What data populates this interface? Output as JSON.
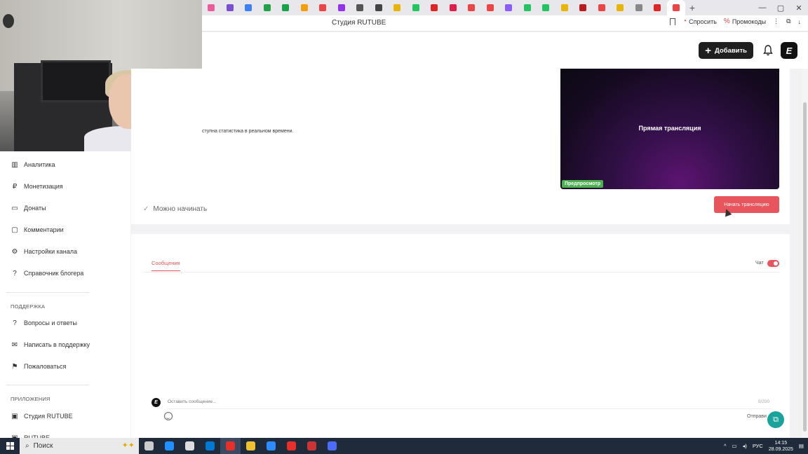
{
  "browser": {
    "page_title": "Студия RUTUBE",
    "tab_colors": [
      "#e85d9a",
      "#7a4fd6",
      "#3b82f6",
      "#22a34a",
      "#16a34a",
      "#f59e0b",
      "#ef4444",
      "#9333ea",
      "#555555",
      "#444444",
      "#eab308",
      "#22c55e",
      "#dc2626",
      "#e11d48",
      "#ef4444",
      "#ef4444",
      "#8b5cf6",
      "#22c55e",
      "#22c55e",
      "#eab308",
      "#b91c1c",
      "#ef4444",
      "#eab308",
      "#888888",
      "#dc2626",
      "#ef4444"
    ],
    "new_tab_symbol": "+",
    "ask_label": "Спросить",
    "promo_label": "Промокоды",
    "menu_symbol": "⋮"
  },
  "header": {
    "add_button_label": "Добавить",
    "plus_symbol": "+",
    "brand_letter": "E"
  },
  "sidebar": {
    "items": [
      {
        "label": "Аналитика",
        "icon": "chart-icon",
        "glyph": "▥"
      },
      {
        "label": "Монетизация",
        "icon": "ruble-icon",
        "glyph": "₽"
      },
      {
        "label": "Донаты",
        "icon": "wallet-icon",
        "glyph": "▭"
      },
      {
        "label": "Комментарии",
        "icon": "comments-icon",
        "glyph": "▢"
      },
      {
        "label": "Настройки канала",
        "icon": "gear-icon",
        "glyph": "⚙"
      },
      {
        "label": "Справочник блогера",
        "icon": "help-icon",
        "glyph": "?"
      }
    ],
    "support_group": "ПОДДЕРЖКА",
    "support_items": [
      {
        "label": "Вопросы и ответы",
        "icon": "question-icon",
        "glyph": "?"
      },
      {
        "label": "Написать в поддержку",
        "icon": "mail-icon",
        "glyph": "✉"
      },
      {
        "label": "Пожаловаться",
        "icon": "flag-icon",
        "glyph": "⚑"
      }
    ],
    "apps_group": "ПРИЛОЖЕНИЯ",
    "apps_items": [
      {
        "label": "Студия RUTUBE",
        "icon": "studio-icon",
        "glyph": "▣"
      },
      {
        "label": "RUTUBE",
        "icon": "rutube-icon",
        "glyph": "▣"
      }
    ]
  },
  "stream": {
    "stats_note": "ступна статистика в реальном времени.",
    "preview_title": "Прямая трансляция",
    "preview_badge": "Предпросмотр",
    "status": "Можно начинать",
    "check_symbol": "✓",
    "start_button": "Начать трансляцию"
  },
  "chat": {
    "tab_label": "Сообщения",
    "toggle_label": "Чат",
    "toggle_on": true,
    "avatar_letter": "E",
    "input_placeholder": "Оставить сообщение...",
    "char_count": "0/200",
    "send_label": "Отправи",
    "float_symbol": "⧉"
  },
  "taskbar": {
    "search_label": "Поиск",
    "search_symbol": "⌕",
    "search_deco": "✦✦",
    "app_colors": [
      "#cccccc",
      "#1e90ff",
      "#dddddd",
      "#0078d4",
      "#e8302a",
      "#f2c12e",
      "#2d8cff",
      "#e8302a",
      "#cc3333",
      "#4a6cf7"
    ],
    "lang": "РУС",
    "time": "14:15",
    "date": "28.09.2025",
    "tray_up": "^"
  }
}
